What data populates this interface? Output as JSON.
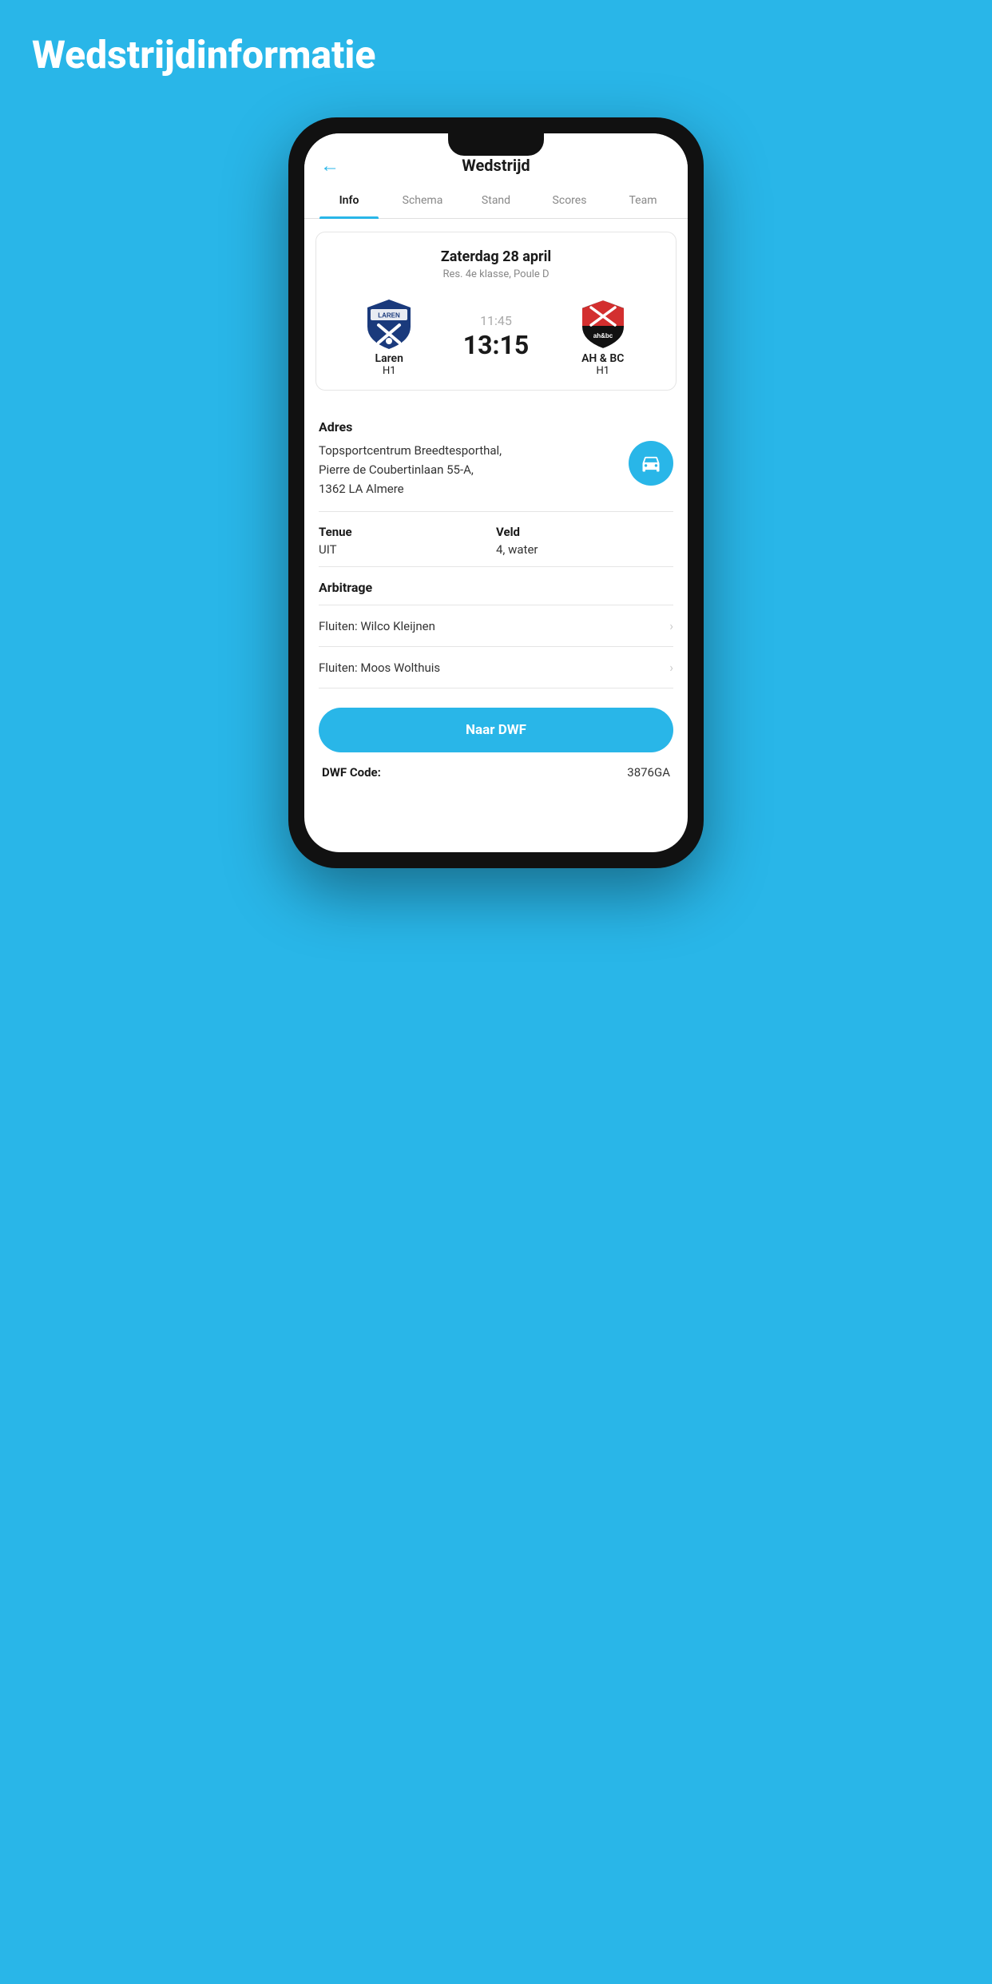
{
  "page": {
    "bg_title": "Wedstrijdinformatie"
  },
  "header": {
    "back_label": "←",
    "title": "Wedstrijd"
  },
  "tabs": [
    {
      "label": "Info",
      "active": true
    },
    {
      "label": "Schema",
      "active": false
    },
    {
      "label": "Stand",
      "active": false
    },
    {
      "label": "Scores",
      "active": false
    },
    {
      "label": "Team",
      "active": false
    }
  ],
  "match": {
    "date": "Zaterdag 28 april",
    "league": "Res. 4e klasse, Poule D",
    "home_team_name": "Laren",
    "home_team_sub": "H1",
    "away_team_name": "AH & BC",
    "away_team_sub": "H1",
    "time": "11:45",
    "score": "13:15"
  },
  "address": {
    "label": "Adres",
    "value": "Topsportcentrum Breedtesporthal,\nPierre de Coubertinlaan 55-A,\n1362 LA Almere"
  },
  "tenue": {
    "label": "Tenue",
    "value": "UIT"
  },
  "veld": {
    "label": "Veld",
    "value": "4, water"
  },
  "arbitrage": {
    "title": "Arbitrage",
    "items": [
      {
        "text": "Fluiten: Wilco Kleijnen"
      },
      {
        "text": "Fluiten: Moos Wolthuis"
      }
    ]
  },
  "naar_dwf_btn": "Naar DWF",
  "dwf_code": {
    "label": "DWF Code:",
    "value": "3876GA"
  }
}
